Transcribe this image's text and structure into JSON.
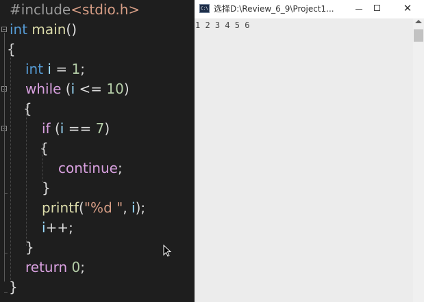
{
  "editor": {
    "lines": [
      {
        "parts": [
          {
            "t": "#include",
            "c": "pre"
          },
          {
            "t": "<stdio.h>",
            "c": "inc"
          }
        ]
      },
      {
        "parts": [
          {
            "t": "int",
            "c": "kw"
          },
          {
            "t": " main",
            "c": "fn"
          },
          {
            "t": "()",
            "c": "txt"
          }
        ]
      },
      {
        "parts": [
          {
            "t": "{",
            "c": "txt"
          }
        ]
      },
      {
        "parts": [
          {
            "t": "int",
            "c": "kw"
          },
          {
            "t": " i",
            "c": "id"
          },
          {
            "t": " = ",
            "c": "txt"
          },
          {
            "t": "1",
            "c": "num"
          },
          {
            "t": ";",
            "c": "txt"
          }
        ]
      },
      {
        "parts": [
          {
            "t": "while",
            "c": "ctrl"
          },
          {
            "t": " (",
            "c": "txt"
          },
          {
            "t": "i",
            "c": "id"
          },
          {
            "t": " <= ",
            "c": "txt"
          },
          {
            "t": "10",
            "c": "num"
          },
          {
            "t": ")",
            "c": "txt"
          }
        ]
      },
      {
        "parts": [
          {
            "t": "{",
            "c": "txt"
          }
        ]
      },
      {
        "parts": [
          {
            "t": "if",
            "c": "ctrl"
          },
          {
            "t": " (",
            "c": "txt"
          },
          {
            "t": "i",
            "c": "id"
          },
          {
            "t": " == ",
            "c": "txt"
          },
          {
            "t": "7",
            "c": "num"
          },
          {
            "t": ")",
            "c": "txt"
          }
        ]
      },
      {
        "parts": [
          {
            "t": "{",
            "c": "txt"
          }
        ]
      },
      {
        "parts": [
          {
            "t": "continue",
            "c": "ctrl"
          },
          {
            "t": ";",
            "c": "txt"
          }
        ]
      },
      {
        "parts": [
          {
            "t": "}",
            "c": "txt"
          }
        ]
      },
      {
        "parts": [
          {
            "t": "printf",
            "c": "fn"
          },
          {
            "t": "(",
            "c": "txt"
          },
          {
            "t": "\"%d \"",
            "c": "str"
          },
          {
            "t": ", ",
            "c": "txt"
          },
          {
            "t": "i",
            "c": "id"
          },
          {
            "t": ");",
            "c": "txt"
          }
        ]
      },
      {
        "parts": [
          {
            "t": "i",
            "c": "id"
          },
          {
            "t": "++;",
            "c": "txt"
          }
        ]
      },
      {
        "parts": [
          {
            "t": "}",
            "c": "txt"
          }
        ]
      },
      {
        "parts": [
          {
            "t": "return",
            "c": "ctrl"
          },
          {
            "t": " ",
            "c": "txt"
          },
          {
            "t": "0",
            "c": "num"
          },
          {
            "t": ";",
            "c": "txt"
          }
        ]
      },
      {
        "parts": [
          {
            "t": "}",
            "c": "txt"
          }
        ]
      }
    ]
  },
  "console": {
    "icon_label": "C:\\",
    "title": "选择D:\\Review_6_9\\Project1...",
    "output": "1 2 3 4 5 6",
    "close_label": "✕"
  }
}
